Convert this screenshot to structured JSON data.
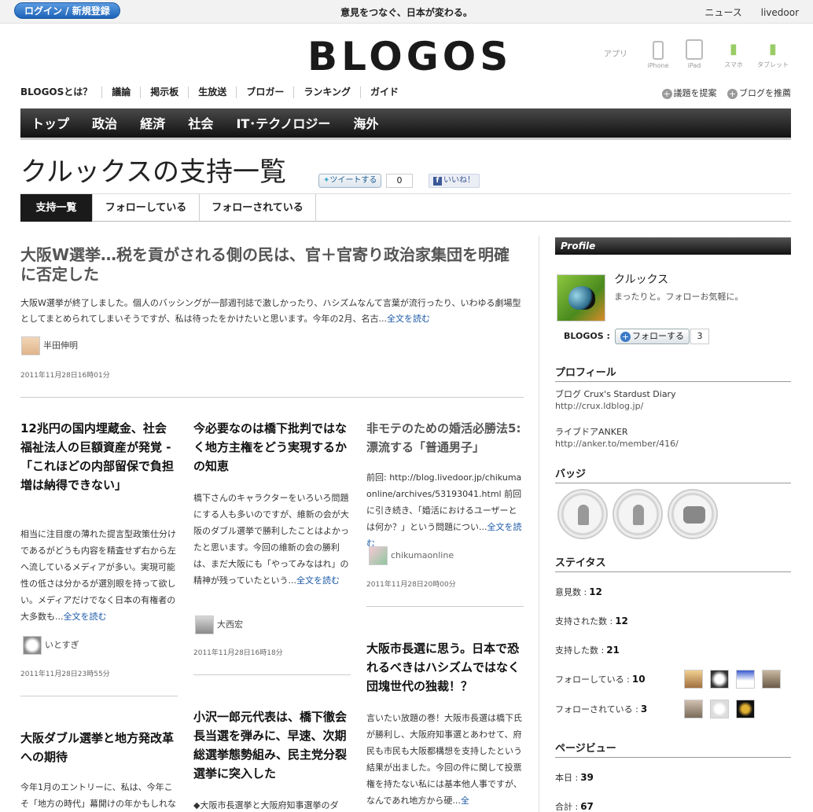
{
  "top": {
    "login_label": "ログイン / 新規登録",
    "tagline": "意見をつなぐ、日本が変わる。",
    "links": [
      "ニュース",
      "livedoor"
    ]
  },
  "logo": "BLOGOS",
  "apps": {
    "label": "アプリ",
    "devices": [
      "iPhone",
      "iPad",
      "スマホ",
      "タブレット"
    ]
  },
  "subnav": {
    "items": [
      "BLOGOSとは？",
      "議論",
      "掲示板",
      "生放送",
      "ブロガー",
      "ランキング",
      "ガイド"
    ],
    "right": [
      "議題を提案",
      "ブログを推薦"
    ]
  },
  "mainnav": [
    "トップ",
    "政治",
    "経済",
    "社会",
    "IT･テクノロジー",
    "海外"
  ],
  "page": {
    "title": "クルックスの支持一覧",
    "tweet_label": "ツイートする",
    "tweet_count": "0",
    "like_label": "いいね！"
  },
  "tabs": [
    "支持一覧",
    "フォローしている",
    "フォローされている"
  ],
  "lead": {
    "title": "大阪W選挙…税を貢がされる側の民は、官＋官寄り政治家集団を明確に否定した",
    "text": "大阪W選挙が終了しました。個人のバッシングが一部週刊誌で激しかったり、ハシズムなんて言葉が流行ったり、いわゆる劇場型としてまとめられてしまいそうですが、私は待ったをかけたいと思います。今年の2月、名古...",
    "more": "全文を読む",
    "author": "半田伸明",
    "date": "2011年11月28日16時01分"
  },
  "articles": [
    {
      "title": "12兆円の国内埋蔵金、社会福祉法人の巨額資産が発覚 -「これほどの内部留保で負担増は納得できない」",
      "text": "相当に注目度の薄れた提言型政策仕分けであるがどうも内容を精査せず右から左へ流しているメディアが多い。実現可能性の低さは分かるが選別眼を持って欲しい。メディアだけでなく日本の有権者の大多数も...",
      "more": "全文を読む",
      "author": "いとすぎ",
      "date": "2011年11月28日23時55分"
    },
    {
      "title": "今必要なのは橋下批判ではなく地方主権をどう実現するかの知恵",
      "text": "橋下さんのキャラクターをいろいろ問題にする人も多いのですが、維新の会が大阪のダブル選挙で勝利したことはよかったと思います。今回の維新の会の勝利は、まだ大阪にも「やってみなはれ」の精神が残っていたという...",
      "more": "全文を読む",
      "author": "大西宏",
      "date": "2011年11月28日16時18分"
    },
    {
      "title": "非モテのための婚活必勝法5: 漂流する「普通男子」",
      "text": "前回: http://blog.livedoor.jp/chikumaonline/archives/53193041.html 前回に引き続き、「婚活におけるユーザーとは何か？」という問題につい...",
      "more": "全文を読む",
      "author": "chikumaonline",
      "date": "2011年11月28日20時00分"
    },
    {
      "title": "大阪ダブル選挙と地方発改革への期待",
      "text": "今年1月のエントリーに、私は、今年こそ「地方の時代」幕開けの年かもしれな"
    },
    {
      "title": "小沢一郎元代表は、橋下徹会長当選を弾みに、早速、次期総選挙態勢組み、民主党分裂選挙に突入した",
      "text": "◆大阪市長選挙と大阪府知事選挙のダ"
    },
    {
      "title": "大阪市長選に思う。日本で恐れるべきはハシズムではなく団塊世代の独裁！？",
      "text": "言いたい放題の巻！大阪市長選は橋下氏が勝利し、大阪府知事選とあわせて、府民も市民も大阪都構想を支持したという結果が出ました。今回の件に関して投票権を持たない私には基本他人事ですが、なんであれ地方から硬...",
      "more": "全"
    }
  ],
  "sidebar": {
    "profile_bar": "Profile",
    "name": "クルックス",
    "desc": "まったりと。フォローお気軽に。",
    "blogos_label": "BLOGOS :",
    "follow_label": "フォローする",
    "follow_count": "3",
    "profile_heading": "プロフィール",
    "blog_name": "ブログ  Crux's Stardust Diary",
    "blog_url": "http://crux.ldblog.jp/",
    "anker_name": "ライブドアANKER",
    "anker_url": "http://anker.to/member/416/",
    "badges_heading": "バッジ",
    "status_heading": "ステイタス",
    "stats": [
      {
        "label": "意見数 :",
        "value": "12"
      },
      {
        "label": "支持された数 :",
        "value": "12"
      },
      {
        "label": "支持した数 :",
        "value": "21"
      },
      {
        "label": "フォローしている :",
        "value": "10"
      },
      {
        "label": "フォローされている :",
        "value": "3"
      }
    ],
    "pageview_heading": "ページビュー",
    "pv": [
      {
        "label": "本日 :",
        "value": "39"
      },
      {
        "label": "合計 :",
        "value": "67"
      }
    ]
  }
}
